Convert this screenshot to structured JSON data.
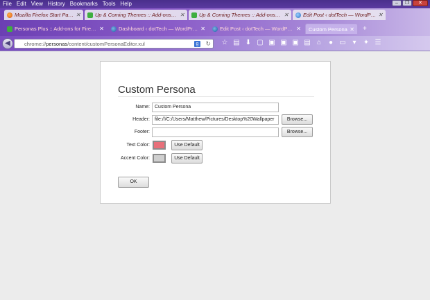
{
  "menu": [
    "File",
    "Edit",
    "View",
    "History",
    "Bookmarks",
    "Tools",
    "Help"
  ],
  "window_controls": [
    "minimize",
    "maximize",
    "close"
  ],
  "tabs_row1": [
    {
      "label": "Mozilla Firefox Start Page",
      "icon": "firefox-icon"
    },
    {
      "label": "Up & Coming Themes :: Add-ons fo...",
      "icon": "puzzle-icon"
    },
    {
      "label": "Up & Coming Themes :: Add-ons f...",
      "icon": "puzzle-icon"
    },
    {
      "label": "Edit Post ‹ dotTech — WordPress",
      "icon": "globe-icon"
    }
  ],
  "tabs_row2": [
    {
      "label": "Personas Plus :: Add-ons for Firefox",
      "icon": "puzzle-icon"
    },
    {
      "label": "Dashboard ‹ dotTech — WordPress",
      "icon": "wordpress-icon"
    },
    {
      "label": "Edit Post ‹ dotTech — WordPress",
      "icon": "wordpress-icon"
    },
    {
      "label": "Custom Persona",
      "icon": "",
      "active": true
    }
  ],
  "urlbar": {
    "prefix": "chrome://",
    "host": "personas",
    "path": "/content/customPersonaEditor.xul"
  },
  "dialog": {
    "title": "Custom Persona",
    "name_label": "Name:",
    "name_value": "Custom Persona",
    "header_label": "Header:",
    "header_value": "file:///C:/Users/Matthew/Pictures/Desktop%20Wallpaper",
    "header_browse": "Browse...",
    "footer_label": "Footer:",
    "footer_value": "",
    "footer_browse": "Browse...",
    "text_color_label": "Text Color:",
    "text_color": "#e8707a",
    "text_color_default": "Use Default",
    "accent_color_label": "Accent Color:",
    "accent_color": "#cfcfcf",
    "accent_color_default": "Use Default",
    "ok_label": "OK"
  }
}
